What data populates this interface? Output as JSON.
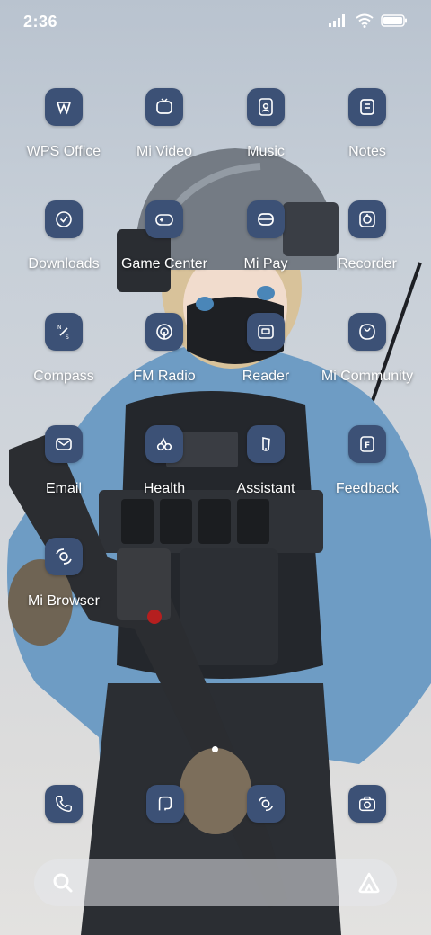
{
  "status_bar": {
    "time": "2:36"
  },
  "apps": [
    {
      "label": "WPS Office",
      "icon": "wps-office-icon"
    },
    {
      "label": "Mi Video",
      "icon": "tv-icon"
    },
    {
      "label": "Music",
      "icon": "music-icon"
    },
    {
      "label": "Notes",
      "icon": "notes-icon"
    },
    {
      "label": "Downloads",
      "icon": "download-icon"
    },
    {
      "label": "Game Center",
      "icon": "gamepad-icon"
    },
    {
      "label": "Mi Pay",
      "icon": "wallet-icon"
    },
    {
      "label": "Recorder",
      "icon": "record-icon"
    },
    {
      "label": "Compass",
      "icon": "compass-icon"
    },
    {
      "label": "FM Radio",
      "icon": "radio-icon"
    },
    {
      "label": "Reader",
      "icon": "reader-icon"
    },
    {
      "label": "Mi Community",
      "icon": "community-icon"
    },
    {
      "label": "Email",
      "icon": "mail-icon"
    },
    {
      "label": "Health",
      "icon": "health-icon"
    },
    {
      "label": "Assistant",
      "icon": "assistant-icon"
    },
    {
      "label": "Feedback",
      "icon": "feedback-icon"
    },
    {
      "label": "Mi Browser",
      "icon": "browser-icon"
    }
  ],
  "dock": [
    {
      "icon": "phone-icon"
    },
    {
      "icon": "messages-icon"
    },
    {
      "icon": "browser-icon"
    },
    {
      "icon": "camera-icon"
    }
  ],
  "theme": {
    "icon_bg": "#3c5176",
    "label_color": "#ffffff"
  }
}
